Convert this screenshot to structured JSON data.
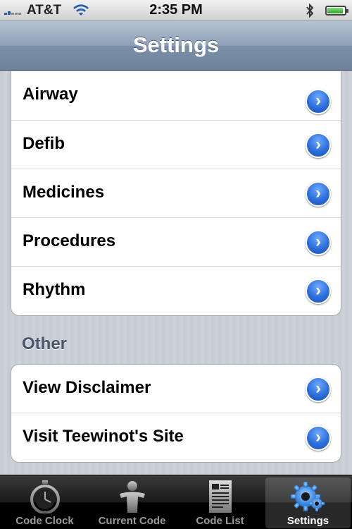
{
  "status_bar": {
    "carrier": "AT&T",
    "time": "2:35 PM",
    "icons": [
      "signal-icon",
      "wifi-icon",
      "bluetooth-icon",
      "battery-icon"
    ]
  },
  "nav_bar": {
    "title": "Settings"
  },
  "settings_group": {
    "items": [
      {
        "label": "Airway",
        "icon": "disclosure-arrow-icon"
      },
      {
        "label": "Defib",
        "icon": "disclosure-arrow-icon"
      },
      {
        "label": "Medicines",
        "icon": "disclosure-arrow-icon"
      },
      {
        "label": "Procedures",
        "icon": "disclosure-arrow-icon"
      },
      {
        "label": "Rhythm",
        "icon": "disclosure-arrow-icon"
      }
    ]
  },
  "other_group": {
    "header": "Other",
    "items": [
      {
        "label": "View Disclaimer",
        "icon": "disclosure-arrow-icon"
      },
      {
        "label": "Visit Teewinot's Site",
        "icon": "disclosure-arrow-icon"
      }
    ]
  },
  "tab_bar": {
    "tabs": [
      {
        "label": "Code Clock",
        "icon": "stopwatch-icon",
        "selected": false
      },
      {
        "label": "Current Code",
        "icon": "person-icon",
        "selected": false
      },
      {
        "label": "Code List",
        "icon": "document-list-icon",
        "selected": false
      },
      {
        "label": "Settings",
        "icon": "gear-icon",
        "selected": true
      }
    ]
  },
  "colors": {
    "nav_bar": "#8e9fb6",
    "disclosure_blue": "#2c6fdc",
    "section_header": "#4c566c",
    "tab_bar": "#1a1a1a"
  }
}
